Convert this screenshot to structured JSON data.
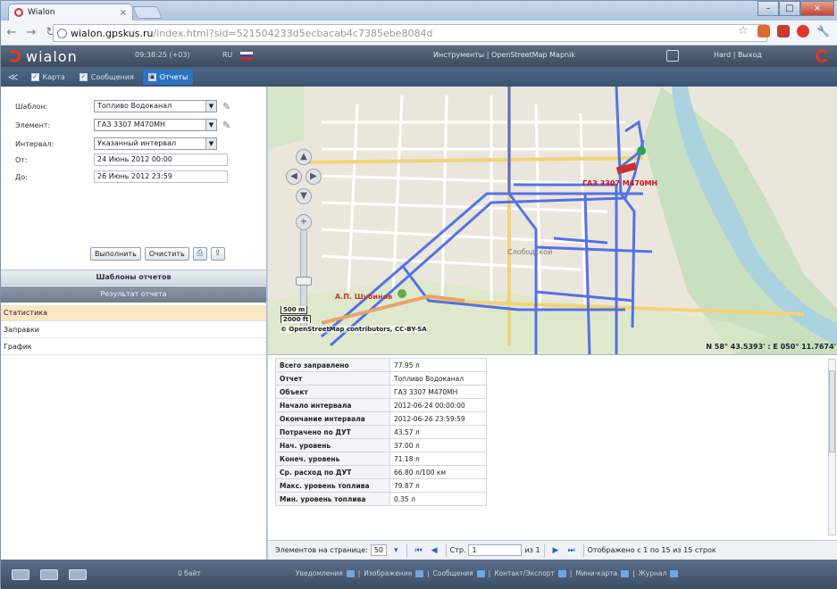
{
  "browser": {
    "tab_title": "Wialon",
    "url_host": "wialon.gpskus.ru",
    "url_path": "/index.html?sid=521504233d5ecbacab4c7385ebe8084d"
  },
  "header": {
    "logo": "wialon",
    "clock": "09:38:25 (+03)",
    "lang": "RU",
    "tools_menu": "Инструменты",
    "map_source": "OpenStreetMap Mapnik",
    "user": "Hard",
    "logout": "Выход"
  },
  "tabs": [
    {
      "label": "Карта",
      "checked": true
    },
    {
      "label": "Сообщения",
      "checked": true
    },
    {
      "label": "Отчеты",
      "active": true
    }
  ],
  "form": {
    "template_label": "Шаблон:",
    "template_value": "Топливо Водоканал",
    "object_label": "Элемент:",
    "object_value": "ГАЗ 3307 М470МН",
    "interval_label": "Интервал:",
    "interval_value": "Указанный интервал",
    "from_label": "От:",
    "from_value": "24 Июнь 2012 00:00",
    "to_label": "До:",
    "to_value": "26 Июнь 2012 23:59",
    "execute_button": "Выполнить",
    "clear_button": "Очистить"
  },
  "sections": {
    "templates": "Шаблоны отчетов",
    "result": "Результат отчета"
  },
  "result_items": [
    "Статистика",
    "Заправки",
    "График"
  ],
  "map": {
    "unit_label": "ГАЗ 3307 М470МН",
    "address_label": "А.П. Шубинов",
    "place_label": "Слободской",
    "scale_top": "500 m",
    "scale_bottom": "2000 ft",
    "copyright": "© OpenStreetMap contributors, CC-BY-SA",
    "coords": "N 58° 43.5393' : E 050° 11.7674'"
  },
  "stats": [
    {
      "k": "Всего заправлено",
      "v": "77.95 л"
    },
    {
      "k": "Отчет",
      "v": "Топливо Водоканал"
    },
    {
      "k": "Объект",
      "v": "ГАЗ 3307 М470МН"
    },
    {
      "k": "Начало интервала",
      "v": "2012-06-24 00:00:00"
    },
    {
      "k": "Окончание интервала",
      "v": "2012-06-26 23:59:59"
    },
    {
      "k": "Потрачено по ДУТ",
      "v": "43.57 л"
    },
    {
      "k": "Нач. уровень",
      "v": "37.00 л"
    },
    {
      "k": "Конеч. уровень",
      "v": "71.18 л"
    },
    {
      "k": "Ср. расход по ДУТ",
      "v": "66.80 л/100 км"
    },
    {
      "k": "Макс. уровень топлива",
      "v": "79.87 л"
    },
    {
      "k": "Мин. уровень топлива",
      "v": "0.35 л"
    }
  ],
  "pager": {
    "per_page_label": "Элементов на странице:",
    "per_page": "50",
    "page_label": "Стр.",
    "page": "1",
    "of": "из 1",
    "shown": "Отображено с 1 по 15 из 15 строк"
  },
  "bottom": {
    "status": "0 байт",
    "links": [
      "Уведомления",
      "Изображения",
      "Сообщения",
      "Контакт/Экспорт",
      "Мини-карта",
      "Журнал"
    ]
  }
}
